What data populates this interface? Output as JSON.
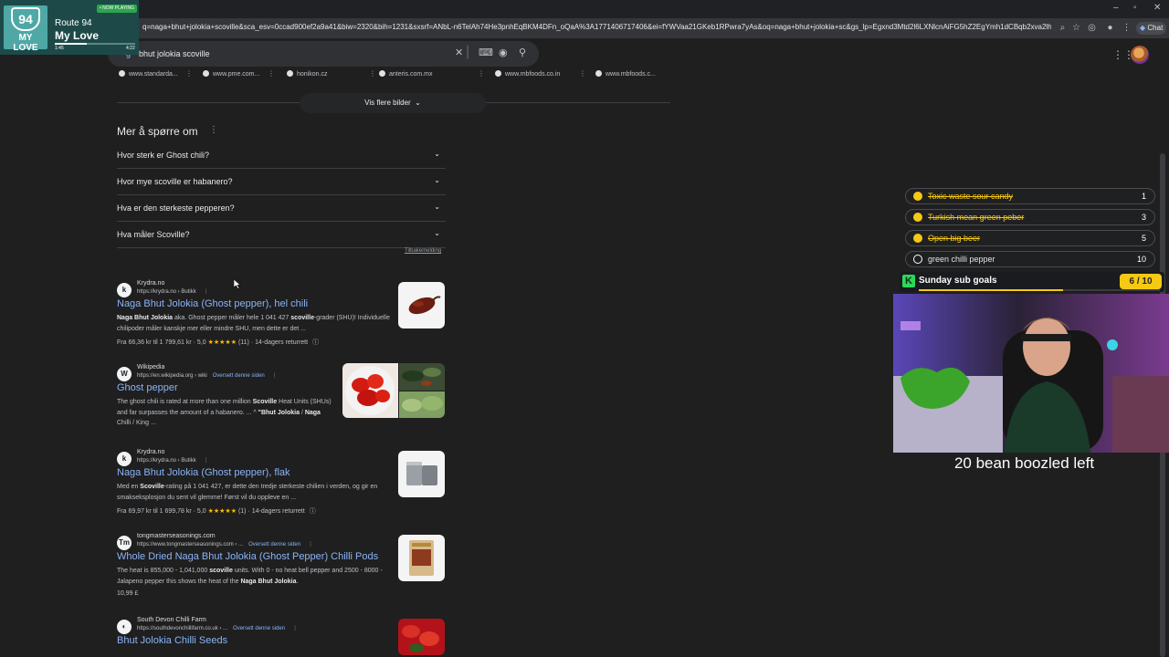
{
  "browser": {
    "url": "q=naga+bhut+jolokia+scoville&sca_esv=0ccad900ef2a9a41&biw=2320&bih=1231&sxsrf=ANbL-n6TelAh74He3pnhEqBKM4DFn_oQaA%3A1771406717406&ei=fYWVaa21GKeb1RPwra7yAs&oq=naga+bhut+jolokia+sc&gs_lp=Egxnd3Mtd2l6LXNlcnAiFG5hZ2EgYmh1dCBqb2xva2lhIHNjKgIIADIEAAYgAQYywEyBhAAGBYYHjI...",
    "chat_label": "Chat",
    "window_controls": [
      "–",
      "▫",
      "✕"
    ]
  },
  "search": {
    "query": "bhut jolokia scoville",
    "query_prefix": "g"
  },
  "image_sources": [
    "www.standarda...",
    "www.pme.com...",
    "honikon.cz",
    "anteris.com.mx",
    "www.mbfoods.co.in",
    "www.mbfoods.c..."
  ],
  "more_images_label": "Vis flere bilder",
  "paa": {
    "title": "Mer å spørre om",
    "questions": [
      "Hvor sterk er Ghost chili?",
      "Hvor mye scoville er habanero?",
      "Hva er den sterkeste pepperen?",
      "Hva måler Scoville?"
    ],
    "feedback": "Tilbakemelding"
  },
  "results": [
    {
      "site": "Krydra.no",
      "url": "https://krydra.no › Butikk",
      "translate": "",
      "title": "Naga Bhut Jolokia (Ghost pepper), hel chili",
      "snippet_html": "<b>Naga Bhut Jolokia</b> aka. Ghost pepper måler hele 1 041 427 <b>scoville</b>-grader (SHU)! Individuelle chilipoder måler kanskje mer eller mindre SHU, men dette er det ...",
      "meta": "Fra 66,36 kr til 1 799,61 kr · 5,0 ★★★★★ (11) · 14-dagers returrett"
    },
    {
      "site": "Wikipedia",
      "url": "https://en.wikipedia.org › wiki",
      "translate": "Oversett denne siden",
      "title": "Ghost pepper",
      "snippet_html": "The ghost chili is rated at more than one million <b>Scoville</b> Heat Units (SHUs) and far surpasses the amount of a habanero. ... ^ <b>\"Bhut Jolokia</b> / <b>Naga</b> Chilli / King ...",
      "meta": ""
    },
    {
      "site": "Krydra.no",
      "url": "https://krydra.no › Butikk",
      "translate": "",
      "title": "Naga Bhut Jolokia (Ghost pepper), flak",
      "snippet_html": "Med en <b>Scoville</b>-rating på 1 041 427, er dette den tredje sterkeste chilien i verden, og gir en smakseksplosjon du sent vil glemme! Først vil du oppleve en ...",
      "meta": "Fra 69,97 kr til 1 699,78 kr · 5,0 ★★★★★ (1) · 14-dagers returrett"
    },
    {
      "site": "tongmasterseasonings.com",
      "url": "https://www.tongmasterseasonings.com › ...",
      "translate": "Oversett denne siden",
      "title": "Whole Dried Naga Bhut Jolokia (Ghost Pepper) Chilli Pods",
      "snippet_html": "The heat is 855,000 - 1,041,000 <b>scoville</b> units. With 0 - no heat bell pepper and 2500 - 8000 - Jalapeno pepper this shows the heat of the <b>Naga Bhut Jolokia</b>.",
      "meta": "10,99 £"
    },
    {
      "site": "South Devon Chilli Farm",
      "url": "https://southdevonchillifarm.co.uk › ...",
      "translate": "Oversett denne siden",
      "title": "Bhut Jolokia Chilli Seeds",
      "snippet_html": "",
      "meta": ""
    }
  ],
  "now_playing": {
    "badge": "• NOW PLAYING",
    "artist": "Route 94",
    "song": "My Love",
    "cover_route": "94",
    "cover_title": "MY LOVE",
    "elapsed": "1:45",
    "duration": "4:22",
    "progress": 0.4
  },
  "goals": [
    {
      "text": "Toxic waste sour candy",
      "count": "1",
      "done": true
    },
    {
      "text": "Turkish mean green peber",
      "count": "3",
      "done": true
    },
    {
      "text": "Open big beer",
      "count": "5",
      "done": true
    },
    {
      "text": "green chilli pepper",
      "count": "10",
      "done": false
    }
  ],
  "sub_goal": {
    "label": "Sunday sub goals",
    "count": "6 / 10",
    "progress": 0.6
  },
  "overlay_text": "20 bean boozled left",
  "colors": {
    "accent_yellow": "#f6c915",
    "link_blue": "#8ab4f8",
    "page_bg": "#1f1f1f"
  }
}
